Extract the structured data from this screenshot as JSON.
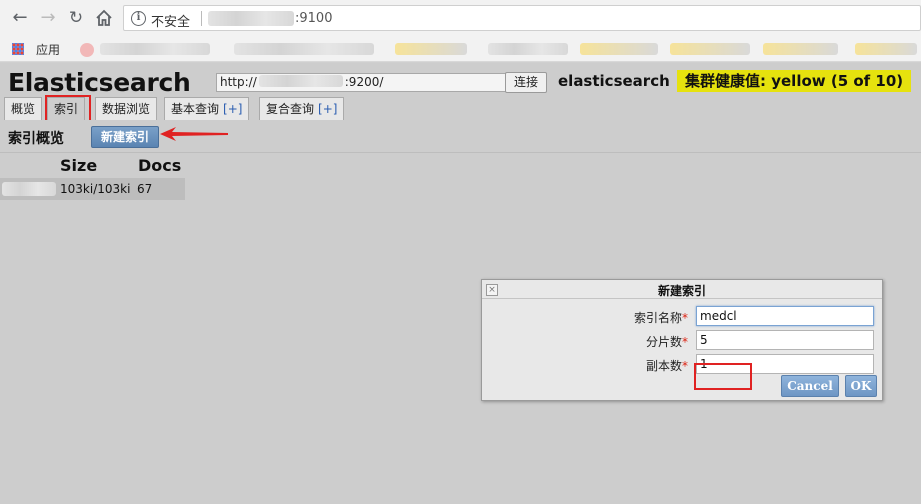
{
  "browser": {
    "security_label": "不安全",
    "url_suffix": ":9100",
    "bookmarks": {
      "apps_label": "应用"
    }
  },
  "app": {
    "title": "Elasticsearch",
    "cluster_url": {
      "prefix": "http://",
      "suffix": ":9200/"
    },
    "connect_label": "连接",
    "cluster_name": "elasticsearch",
    "health_label": "集群健康值: yellow (5 of 10)",
    "health_color": "#e6e20e",
    "tabs": [
      {
        "label": "概览",
        "plus": ""
      },
      {
        "label": "索引",
        "plus": ""
      },
      {
        "label": "数据浏览",
        "plus": ""
      },
      {
        "label": "基本查询",
        "plus": "[+]"
      },
      {
        "label": "复合查询",
        "plus": "[+]"
      }
    ],
    "active_tab": "索引",
    "section": {
      "title": "索引概览",
      "new_index_button": "新建索引"
    },
    "index_table": {
      "headers": [
        "Size",
        "Docs"
      ],
      "rows": [
        {
          "size": "103ki/103ki",
          "docs": "67"
        }
      ]
    }
  },
  "dialog": {
    "title": "新建索引",
    "close_icon": "close-icon",
    "fields": [
      {
        "label": "索引名称",
        "value": "medcl"
      },
      {
        "label": "分片数",
        "value": "5"
      },
      {
        "label": "副本数",
        "value": "1"
      }
    ],
    "required_mark": "*",
    "cancel_label": "Cancel",
    "ok_label": "OK"
  }
}
